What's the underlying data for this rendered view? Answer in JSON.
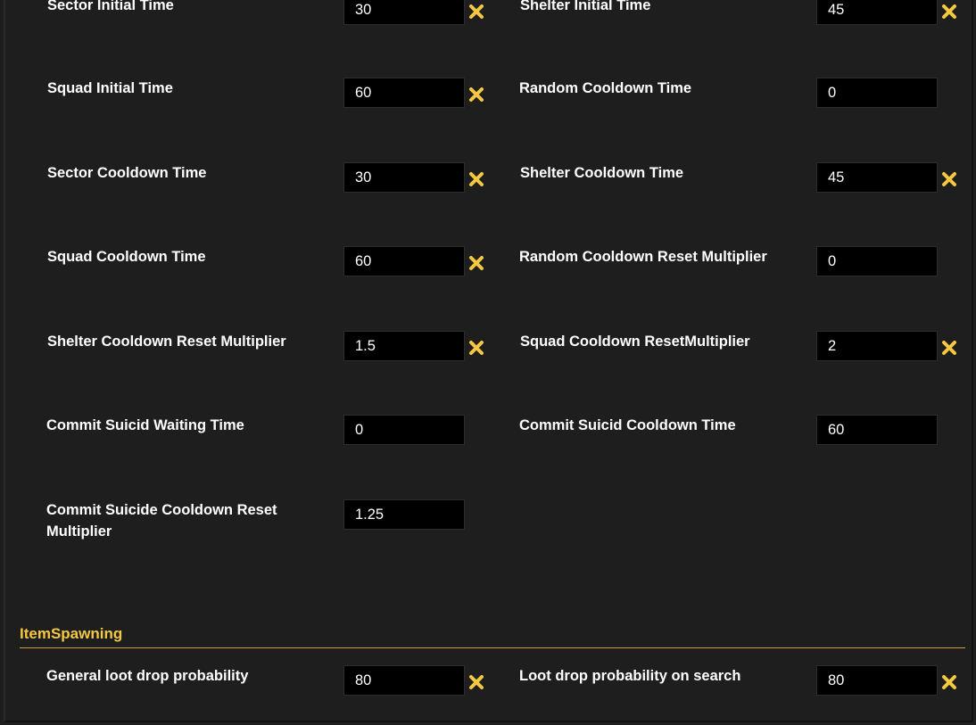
{
  "fields": [
    {
      "key": "sector_initial_time",
      "label": "Sector Initial Time",
      "value": "30",
      "clearable": true
    },
    {
      "key": "shelter_initial_time",
      "label": "Shelter Initial Time",
      "value": "45",
      "clearable": true
    },
    {
      "key": "squad_initial_time",
      "label": "Squad Initial Time",
      "value": "60",
      "clearable": true
    },
    {
      "key": "random_cooldown_time",
      "label": "Random Cooldown Time",
      "value": "0",
      "clearable": false
    },
    {
      "key": "sector_cooldown_time",
      "label": "Sector Cooldown Time",
      "value": "30",
      "clearable": true
    },
    {
      "key": "shelter_cooldown_time",
      "label": "Shelter Cooldown Time",
      "value": "45",
      "clearable": true
    },
    {
      "key": "squad_cooldown_time",
      "label": "Squad Cooldown Time",
      "value": "60",
      "clearable": true
    },
    {
      "key": "random_cooldown_reset_multiplier",
      "label": "Random Cooldown Reset Multiplier",
      "value": "0",
      "clearable": false
    },
    {
      "key": "shelter_cooldown_reset_multiplier",
      "label": "Shelter Cooldown Reset Multiplier",
      "value": "1.5",
      "clearable": true
    },
    {
      "key": "squad_cooldown_reset_multiplier",
      "label": "Squad Cooldown ResetMultiplier",
      "value": "2",
      "clearable": true
    },
    {
      "key": "commit_suicid_waiting_time",
      "label": "Commit Suicid Waiting Time",
      "value": "0",
      "clearable": false
    },
    {
      "key": "commit_suicid_cooldown_time",
      "label": "Commit Suicid Cooldown Time",
      "value": "60",
      "clearable": false
    },
    {
      "key": "commit_suicide_cooldown_reset_multiplier",
      "label": "Commit Suicide Cooldown Reset Multiplier",
      "value": "1.25",
      "clearable": false
    }
  ],
  "item_spawning": {
    "title": "ItemSpawning",
    "fields": [
      {
        "key": "general_loot_drop_probability",
        "label": "General loot drop probability",
        "value": "80",
        "clearable": true
      },
      {
        "key": "loot_drop_probability_on_search",
        "label": "Loot drop probability on search",
        "value": "80",
        "clearable": true
      }
    ]
  },
  "colors": {
    "background": "#1e1e1e",
    "input_background": "#000000",
    "accent": "#f5c842",
    "clear_icon": "#f5c842"
  },
  "icons": {
    "clear": "close-icon"
  }
}
